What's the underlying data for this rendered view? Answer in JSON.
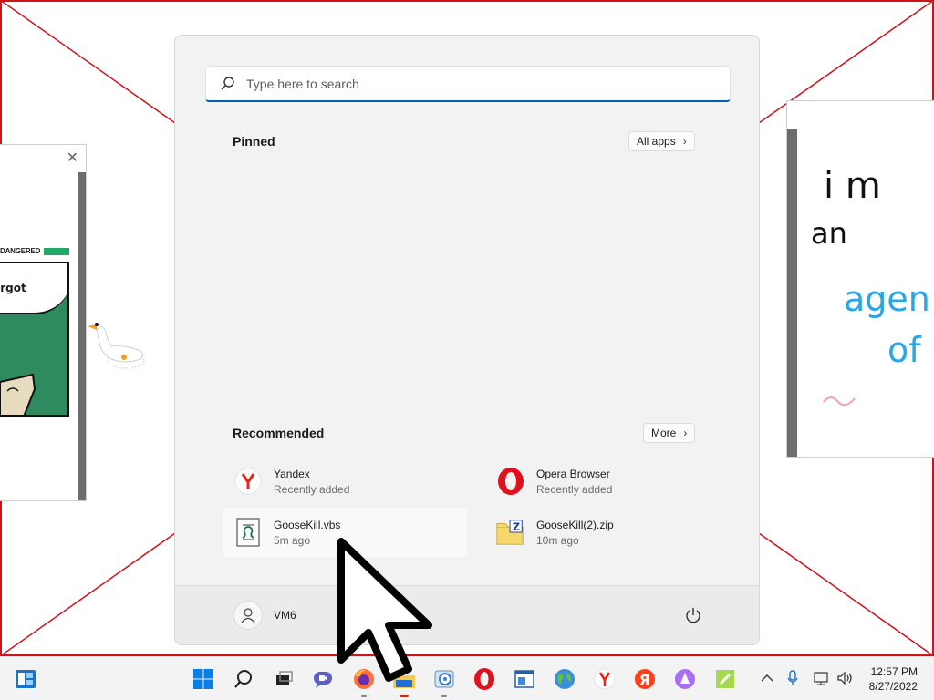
{
  "search": {
    "placeholder": "Type here to search"
  },
  "pinned": {
    "title": "Pinned",
    "all_apps": "All apps"
  },
  "recommended": {
    "title": "Recommended",
    "more": "More",
    "items": [
      {
        "name": "Yandex",
        "sub": "Recently added",
        "icon": "yandex-icon"
      },
      {
        "name": "Opera Browser",
        "sub": "Recently added",
        "icon": "opera-icon"
      },
      {
        "name": "GooseKill.vbs",
        "sub": "5m ago",
        "icon": "vbs-script-icon"
      },
      {
        "name": "GooseKill(2).zip",
        "sub": "10m ago",
        "icon": "zip-folder-icon"
      }
    ]
  },
  "user": {
    "name": "VM6"
  },
  "clock": {
    "time": "12:57 PM",
    "date": "8/27/2022"
  },
  "left_window": {
    "comic_word": "orgot",
    "comic_tag": "DANGERED"
  },
  "right_window": {
    "handwriting": [
      "i m",
      "an",
      "agen",
      "of"
    ]
  },
  "colors": {
    "accent": "#005fb8",
    "wallpaper_line": "#d0121b",
    "taskbar_active": "#c42b1c"
  }
}
